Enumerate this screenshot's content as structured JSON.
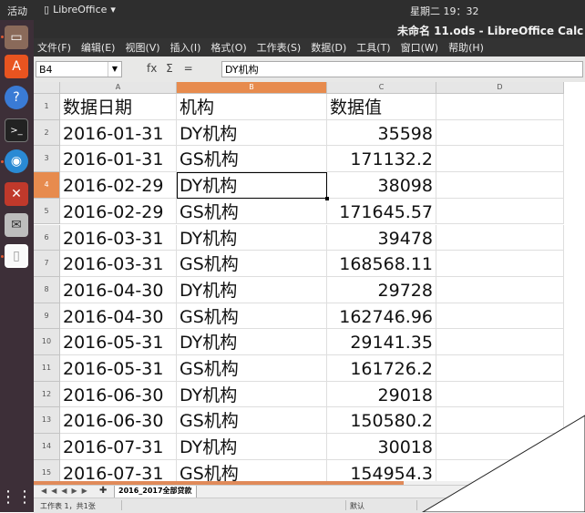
{
  "system_bar": {
    "activities": "活动",
    "app_name": "LibreOffice",
    "clock": "星期二 19：32"
  },
  "window": {
    "title": "未命名 11.ods - LibreOffice Calc"
  },
  "menu": [
    "文件(F)",
    "编辑(E)",
    "视图(V)",
    "插入(I)",
    "格式(O)",
    "工作表(S)",
    "数据(D)",
    "工具(T)",
    "窗口(W)",
    "帮助(H)"
  ],
  "formula_bar": {
    "cell_ref": "B4",
    "function_icon": "fx",
    "sum_icon": "Σ",
    "equals_icon": "=",
    "content": "DY机构"
  },
  "dock": [
    "files-icon",
    "software-icon",
    "help-icon",
    "terminal-icon",
    "browser-icon",
    "settings-icon",
    "mail-icon",
    "document-icon",
    "apps-grid-icon"
  ],
  "columns": [
    "A",
    "B",
    "C",
    "D"
  ],
  "active_cell": {
    "col": "B",
    "row": "4"
  },
  "rows": [
    {
      "num": "1",
      "a": "数据日期",
      "b": "机构",
      "c": "数据值"
    },
    {
      "num": "2",
      "a": "2016-01-31",
      "b": "DY机构",
      "c": "35598"
    },
    {
      "num": "3",
      "a": "2016-01-31",
      "b": "GS机构",
      "c": "171132.2"
    },
    {
      "num": "4",
      "a": "2016-02-29",
      "b": "DY机构",
      "c": "38098"
    },
    {
      "num": "5",
      "a": "2016-02-29",
      "b": "GS机构",
      "c": "171645.57"
    },
    {
      "num": "6",
      "a": "2016-03-31",
      "b": "DY机构",
      "c": "39478"
    },
    {
      "num": "7",
      "a": "2016-03-31",
      "b": "GS机构",
      "c": "168568.11"
    },
    {
      "num": "8",
      "a": "2016-04-30",
      "b": "DY机构",
      "c": "29728"
    },
    {
      "num": "9",
      "a": "2016-04-30",
      "b": "GS机构",
      "c": "162746.96"
    },
    {
      "num": "10",
      "a": "2016-05-31",
      "b": "DY机构",
      "c": "29141.35"
    },
    {
      "num": "11",
      "a": "2016-05-31",
      "b": "GS机构",
      "c": "161726.2"
    },
    {
      "num": "12",
      "a": "2016-06-30",
      "b": "DY机构",
      "c": "29018"
    },
    {
      "num": "13",
      "a": "2016-06-30",
      "b": "GS机构",
      "c": "150580.2"
    },
    {
      "num": "14",
      "a": "2016-07-31",
      "b": "DY机构",
      "c": "30018"
    },
    {
      "num": "15",
      "a": "2016-07-31",
      "b": "GS机构",
      "c": "154954.3"
    }
  ],
  "sheet_tab": "2016_2017全部贷款",
  "status": {
    "sheet_info": "工作表 1，共1张",
    "style": "默认"
  },
  "colors": {
    "accent": "#e78b4e",
    "dock_bg": "#3d2f38",
    "menu_bg": "#333333"
  }
}
